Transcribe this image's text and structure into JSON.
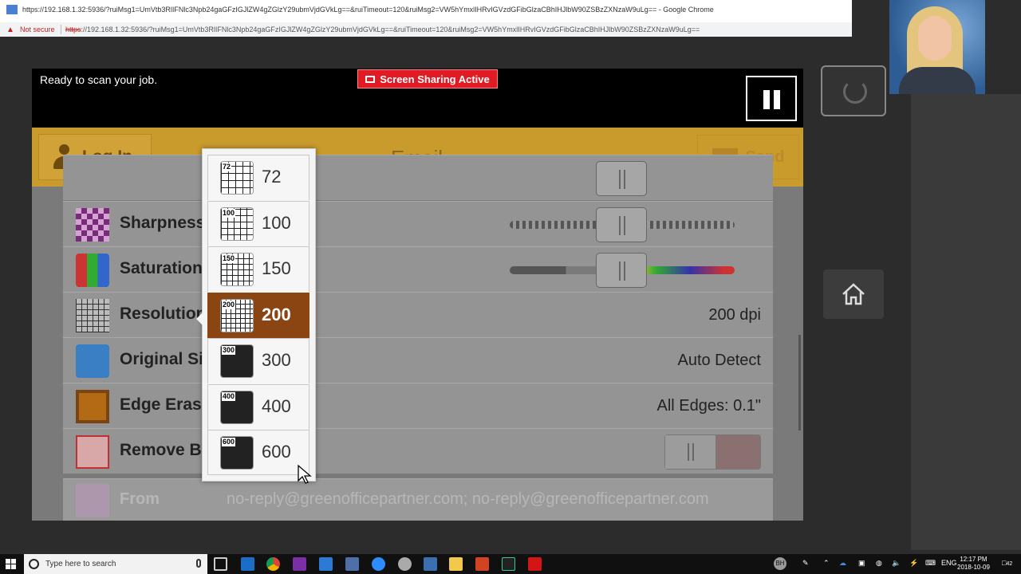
{
  "browser": {
    "title": "https://192.168.1.32:5936/?ruiMsg1=UmVtb3RlIFNlc3Npb24gaGFzIGJlZW4gZGlzY29ubmVjdGVkLg==&ruiTimeout=120&ruiMsg2=VW5hYmxlIHRvIGVzdGFibGlzaCBhIHJlbW90ZSBzZXNzaW9uLg== - Google Chrome",
    "security_label": "Not secure",
    "url_scheme": "https",
    "url_rest": "://192.168.1.32:5936/?ruiMsg1=UmVtb3RlIFNlc3Npb24gaGFzIGJlZW4gZGlzY29ubmVjdGVkLg==&ruiTimeout=120&ruiMsg2=VW5hYmxlIHRvIGVzdGFibGlzaCBhIHJlbW90ZSBzZXNzaW9uLg=="
  },
  "device": {
    "status_text": "Ready to scan your job.",
    "share_badge": "Screen Sharing Active",
    "header": {
      "login_label": "Log In",
      "title": "Email",
      "send_label": "Send"
    },
    "rows": [
      {
        "label": "Sharpness",
        "value": "",
        "icon": "sharpness-icon"
      },
      {
        "label": "Saturation",
        "value": "",
        "icon": "saturation-icon"
      },
      {
        "label": "Resolution",
        "value": "200 dpi",
        "icon": "resolution-icon"
      },
      {
        "label": "Original Size",
        "value": "Auto Detect",
        "icon": "original-size-icon"
      },
      {
        "label": "Edge Erase",
        "value": "All Edges: 0.1\"",
        "icon": "edge-erase-icon"
      },
      {
        "label": "Remove Blank Pages",
        "value": "",
        "icon": "remove-blank-icon"
      }
    ],
    "from": {
      "label": "From",
      "value": "no-reply@greenofficepartner.com; no-reply@greenofficepartner.com"
    },
    "resolution_options": [
      {
        "label": "72",
        "selected": false
      },
      {
        "label": "100",
        "selected": false
      },
      {
        "label": "150",
        "selected": false
      },
      {
        "label": "200",
        "selected": true
      },
      {
        "label": "300",
        "selected": false
      },
      {
        "label": "400",
        "selected": false
      },
      {
        "label": "600",
        "selected": false
      }
    ]
  },
  "taskbar": {
    "search_placeholder": "Type here to search",
    "user_badge": "BH",
    "lang": "ENG",
    "time": "12:17 PM",
    "date": "2018-10-09",
    "notifications": "42"
  },
  "colors": {
    "header_bg": "#c99a2c",
    "selected_option": "#8b4513",
    "share_badge": "#e01b24"
  }
}
